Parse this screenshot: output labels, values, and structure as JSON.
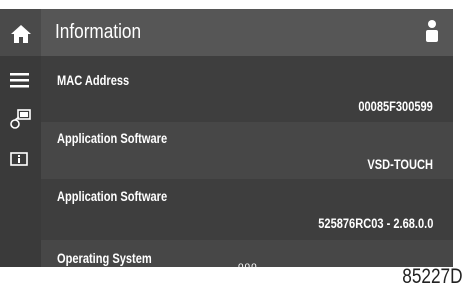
{
  "header": {
    "title": "Information"
  },
  "sidebar": {
    "items": [
      {
        "icon": "home-icon"
      },
      {
        "icon": "menu-icon"
      },
      {
        "icon": "network-icon"
      },
      {
        "icon": "info-icon"
      }
    ]
  },
  "rows": [
    {
      "label": "MAC Address",
      "value": "00085F300599"
    },
    {
      "label": "Application Software",
      "value": "VSD-TOUCH"
    },
    {
      "label": "Application Software",
      "value": "525876RC03 - 2.68.0.0"
    },
    {
      "label": "Operating System",
      "value": ""
    }
  ],
  "pager": {
    "dots": "ooo"
  },
  "figure_id": "85227D",
  "colors": {
    "screen_bg": "#3c3c3c",
    "header_bg": "#565656",
    "row_alt_bg": "#474747",
    "text": "#ffffff"
  }
}
